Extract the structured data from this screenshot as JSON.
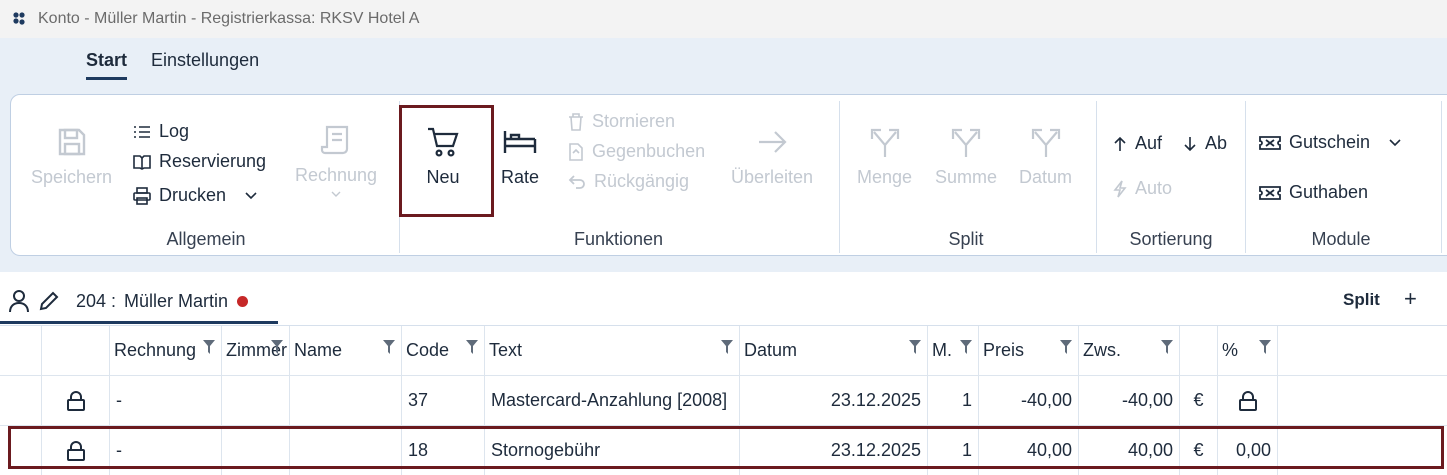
{
  "window": {
    "title": "Konto - Müller Martin - Registrierkassa: RKSV Hotel A"
  },
  "tabs": [
    {
      "label": "Start"
    },
    {
      "label": "Einstellungen"
    }
  ],
  "ribbon": {
    "allgemein": {
      "label": "Allgemein",
      "speichern": "Speichern",
      "log": "Log",
      "reservierung": "Reservierung",
      "drucken": "Drucken",
      "rechnung": "Rechnung"
    },
    "funktionen": {
      "label": "Funktionen",
      "neu": "Neu",
      "rate": "Rate",
      "stornieren": "Stornieren",
      "gegenbuchen": "Gegenbuchen",
      "rueckgaengig": "Rückgängig",
      "ueberleiten": "Überleiten"
    },
    "split": {
      "label": "Split",
      "menge": "Menge",
      "summe": "Summe",
      "datum": "Datum"
    },
    "sortierung": {
      "label": "Sortierung",
      "auf": "Auf",
      "ab": "Ab",
      "auto": "Auto"
    },
    "module": {
      "label": "Module",
      "gutschein": "Gutschein",
      "guthaben": "Guthaben"
    }
  },
  "person": {
    "room": "204 :",
    "name": "Müller Martin"
  },
  "split_tab": {
    "label": "Split",
    "add": "+"
  },
  "table": {
    "columns": [
      "Rechnung",
      "Zimmer",
      "Name",
      "Code",
      "Text",
      "Datum",
      "M.",
      "Preis",
      "Zws.",
      "%"
    ],
    "rows": [
      {
        "rechnung": "-",
        "zimmer": "",
        "name": "",
        "code": "37",
        "text": "Mastercard-Anzahlung [2008]",
        "datum": "23.12.2025",
        "m": "1",
        "preis": "-40,00",
        "zws": "-40,00",
        "cur": "€",
        "pct": ""
      },
      {
        "rechnung": "-",
        "zimmer": "",
        "name": "",
        "code": "18",
        "text": "Stornogebühr",
        "datum": "23.12.2025",
        "m": "1",
        "preis": "40,00",
        "zws": "40,00",
        "cur": "€",
        "pct": "0,00"
      }
    ]
  },
  "colors": {
    "accent": "#1e3a5f",
    "highlight": "#6b1a1f",
    "ribbon_bg": "#e8eff7",
    "disabled": "#c3c9d1",
    "status_dot": "#c62828"
  }
}
